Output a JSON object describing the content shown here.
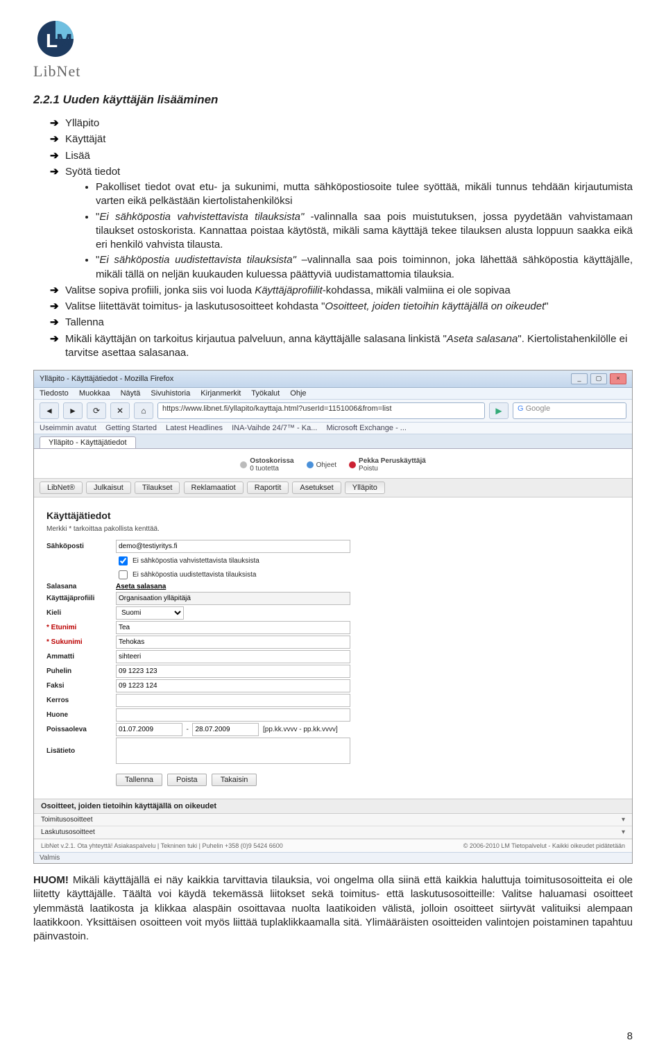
{
  "logo_word": "LibNet",
  "section_title": "2.2.1 Uuden käyttäjän lisääminen",
  "arrow1": {
    "a": "Ylläpito",
    "b": "Käyttäjät",
    "c": "Lisää",
    "d": "Syötä tiedot"
  },
  "bullets": {
    "b1": "Pakolliset tiedot ovat etu- ja sukunimi, mutta sähköpostiosoite tulee syöttää, mikäli tunnus tehdään kirjautumista varten eikä pelkästään kiertolistahenkilöksi",
    "b2_pre": "\"",
    "b2_em": "Ei sähköpostia vahvistettavista tilauksista\"",
    "b2_post": " -valinnalla saa pois muistutuksen, jossa pyydetään vahvistamaan tilaukset ostoskorista. Kannattaa poistaa käytöstä, mikäli sama käyttäjä tekee tilauksen alusta loppuun saakka eikä eri henkilö vahvista tilausta.",
    "b3_pre": "\"",
    "b3_em": "Ei sähköpostia uudistettavista tilauksista\"",
    "b3_post": " –valinnalla saa pois toiminnon, joka lähettää sähköpostia käyttäjälle, mikäli tällä on neljän kuukauden kuluessa päättyviä uudistamattomia tilauksia."
  },
  "arrow2": {
    "a_pre": "Valitse sopiva profiili, jonka siis voi luoda ",
    "a_em": "Käyttäjäprofiilit",
    "a_post": "-kohdassa, mikäli valmiina ei ole sopivaa",
    "b_pre": "Valitse liitettävät toimitus- ja laskutusosoitteet kohdasta \"",
    "b_em": "Osoitteet, joiden tietoihin käyttäjällä on oikeudet",
    "b_post": "\"",
    "c": "Tallenna",
    "d_pre": "Mikäli käyttäjän on tarkoitus kirjautua palveluun, anna käyttäjälle salasana linkistä \"",
    "d_em": "Aseta salasana",
    "d_post": "\". Kiertolistahenkilölle ei tarvitse asettaa salasanaa."
  },
  "browser": {
    "title": "Ylläpito - Käyttäjätiedot - Mozilla Firefox",
    "menus": [
      "Tiedosto",
      "Muokkaa",
      "Näytä",
      "Sivuhistoria",
      "Kirjanmerkit",
      "Työkalut",
      "Ohje"
    ],
    "url": "https://www.libnet.fi/yllapito/kayttaja.html?userId=1151006&from=list",
    "search_ph": "Google",
    "bookmarks_label": "Useimmin avatut",
    "bookmarks": [
      "Getting Started",
      "Latest Headlines",
      "INA-Vaihde 24/7™ - Ka...",
      "Microsoft Exchange - ..."
    ],
    "tab": "Ylläpito - Käyttäjätiedot",
    "status": "Valmis"
  },
  "app": {
    "topbar": {
      "cart_l1": "Ostoskorissa",
      "cart_l2": "0 tuotetta",
      "help": "Ohjeet",
      "user": "Pekka Peruskäyttäjä",
      "logout": "Poistu"
    },
    "nav": [
      "LibNet®",
      "Julkaisut",
      "Tilaukset",
      "Reklamaatiot",
      "Raportit",
      "Asetukset",
      "Ylläpito"
    ],
    "heading": "Käyttäjätiedot",
    "hint": "Merkki * tarkoittaa pakollista kenttää.",
    "form": {
      "email_lbl": "Sähköposti",
      "email": "demo@testiyritys.fi",
      "chk1": "Ei sähköpostia vahvistettavista tilauksista",
      "chk2": "Ei sähköpostia uudistettavista tilauksista",
      "password_lbl": "Salasana",
      "password_link": "Aseta salasana",
      "profile_lbl": "Käyttäjäprofiili",
      "profile": "Organisaation ylläpitäjä",
      "lang_lbl": "Kieli",
      "lang": "Suomi",
      "first_lbl": "* Etunimi",
      "first": "Tea",
      "last_lbl": "* Sukunimi",
      "last": "Tehokas",
      "occ_lbl": "Ammatti",
      "occ": "sihteeri",
      "tel_lbl": "Puhelin",
      "tel": "09 1223 123",
      "fax_lbl": "Faksi",
      "fax": "09 1223 124",
      "floor_lbl": "Kerros",
      "room_lbl": "Huone",
      "away_lbl": "Poissaoleva",
      "away_from": "01.07.2009",
      "away_to": "28.07.2009",
      "away_hint": "[pp.kk.vvvv - pp.kk.vvvv]",
      "extra_lbl": "Lisätieto"
    },
    "buttons": {
      "save": "Tallenna",
      "delete": "Poista",
      "back": "Takaisin"
    },
    "accordion": {
      "head": "Osoitteet, joiden tietoihin käyttäjällä on oikeudet",
      "ship": "Toimitusosoitteet",
      "bill": "Laskutusosoitteet"
    },
    "footer": {
      "left": "LibNet v.2.1. Ota yhteyttä! Asiakaspalvelu | Tekninen tuki | Puhelin +358 (0)9 5424 6600",
      "right": "© 2006-2010 LM Tietopalvelut - Kaikki oikeudet pidätetään"
    }
  },
  "huom_lead": "HUOM!",
  "huom_text": " Mikäli käyttäjällä ei näy kaikkia tarvittavia tilauksia, voi ongelma olla siinä että kaikkia haluttuja toimitusosoitteita ei ole liitetty käyttäjälle. Täältä voi käydä tekemässä liitokset sekä toimitus- että laskutusosoitteille: Valitse haluamasi osoitteet ylemmästä laatikosta ja klikkaa alaspäin osoittavaa nuolta laatikoiden välistä, jolloin osoitteet siirtyvät valituiksi alempaan laatikkoon. Yksittäisen osoitteen voit myös liittää tuplaklikkaamalla sitä. Ylimääräisten osoitteiden valintojen poistaminen tapahtuu päinvastoin.",
  "page_number": "8"
}
